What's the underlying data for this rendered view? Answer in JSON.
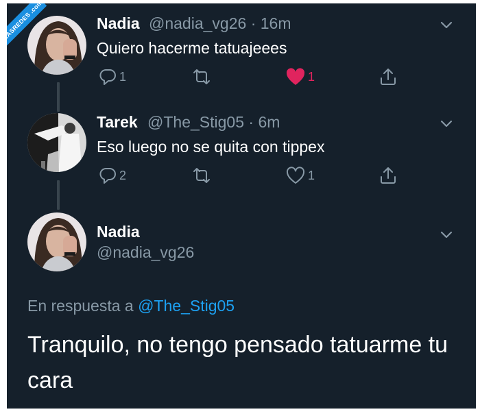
{
  "colors": {
    "background": "#15202b",
    "text_primary": "#ffffff",
    "text_secondary": "#8899a6",
    "accent": "#1da1f2",
    "like_active": "#e0245e"
  },
  "watermark": {
    "text": "VISTOENLASREDES .com"
  },
  "tweets": [
    {
      "name": "Nadia",
      "handle": "@nadia_vg26",
      "time": "· 16m",
      "text": "Quiero hacerme tatuajeees",
      "actions": {
        "reply_count": "1",
        "retweet_count": "",
        "like_count": "1",
        "like_active": true
      }
    },
    {
      "name": "Tarek",
      "handle": "@The_Stig05",
      "time": "· 6m",
      "text": "Eso luego no se quita con tippex",
      "actions": {
        "reply_count": "2",
        "retweet_count": "",
        "like_count": "1",
        "like_active": false
      }
    }
  ],
  "main_tweet": {
    "name": "Nadia",
    "handle": "@nadia_vg26",
    "reply_prefix": "En respuesta a",
    "reply_to": "@The_Stig05",
    "text": "Tranquilo, no tengo pensado tatuarme tu cara"
  }
}
